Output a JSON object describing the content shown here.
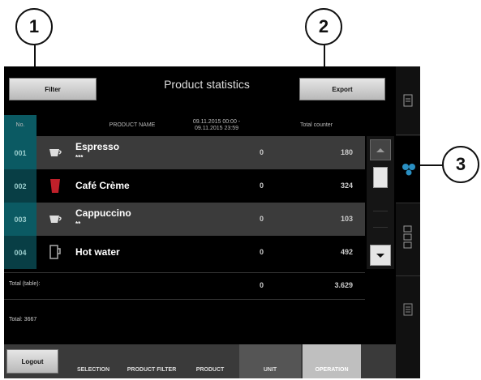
{
  "callouts": [
    "1",
    "2",
    "3"
  ],
  "toolbar": {
    "filter_label": "Filter",
    "title": "Product statistics",
    "export_label": "Export"
  },
  "table": {
    "headers": {
      "no": "No.",
      "name": "PRODUCT NAME",
      "period": "09.11.2015 00:00 - 09.11.2015 23:59",
      "total": "Total counter"
    },
    "rows": [
      {
        "no": "001",
        "name": "Espresso",
        "sub": "***",
        "period": "0",
        "total": "180",
        "icon": "cup-icon"
      },
      {
        "no": "002",
        "name": "Café Crème",
        "sub": "",
        "period": "0",
        "total": "324",
        "icon": "red-cup-icon"
      },
      {
        "no": "003",
        "name": "Cappuccino",
        "sub": "**",
        "period": "0",
        "total": "103",
        "icon": "cup-icon"
      },
      {
        "no": "004",
        "name": "Hot water",
        "sub": "",
        "period": "0",
        "total": "492",
        "icon": "mug-icon"
      }
    ],
    "total_table_label": "Total (table):",
    "total_table_period": "0",
    "total_table_total": "3.629",
    "total_label": "Total: 3667"
  },
  "tabs": {
    "logout": "Logout",
    "selection": "SELECTION",
    "product_filter": "PRODUCT FILTER",
    "product": "PRODUCT",
    "unit": "UNIT",
    "operation": "OPERATION"
  },
  "colors": {
    "teal": "#0b5a63",
    "teal_dark": "#083e45",
    "row_grey": "#3b3b3b",
    "accent_active": "#bfbfbf"
  }
}
